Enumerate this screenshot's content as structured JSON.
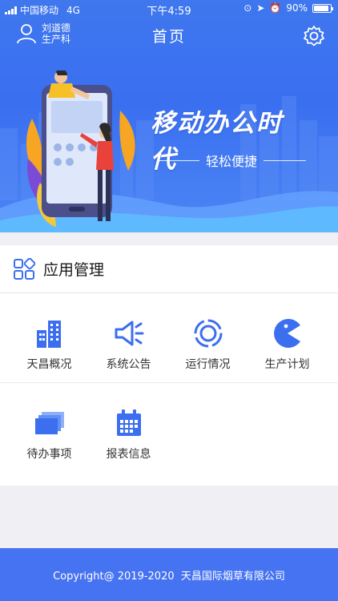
{
  "status_bar": {
    "carrier": "中国移动",
    "network": "4G",
    "time": "下午4:59",
    "battery": "90%"
  },
  "header": {
    "title": "首页",
    "user_name": "刘道德",
    "user_dept": "生产科"
  },
  "banner": {
    "slogan": "移动办公时代",
    "subslogan": "轻松便捷"
  },
  "app_section": {
    "title": "应用管理",
    "apps": [
      {
        "label": "天昌概况",
        "icon": "building-icon"
      },
      {
        "label": "系统公告",
        "icon": "megaphone-icon"
      },
      {
        "label": "运行情况",
        "icon": "circle-gauge-icon"
      },
      {
        "label": "生产计划",
        "icon": "pie-pacman-icon"
      },
      {
        "label": "待办事项",
        "icon": "stacked-cards-icon"
      },
      {
        "label": "报表信息",
        "icon": "calendar-icon"
      }
    ]
  },
  "footer": {
    "copyright": "Copyright@ 2019-2020  天昌国际烟草有限公司"
  },
  "colors": {
    "primary": "#3f77ee",
    "footer": "#4673f2",
    "icon_blue": "#3c6ef0"
  }
}
